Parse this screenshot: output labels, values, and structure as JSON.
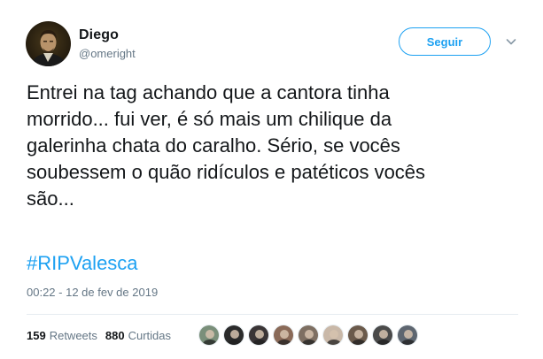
{
  "author": {
    "display_name": "Diego",
    "username": "@omeright",
    "avatar_icon": "profile-photo-icon"
  },
  "follow_label": "Seguir",
  "tweet_text": {
    "lines": [
      "Entrei na tag achando que a cantora tinha",
      "morrido... fui ver, é só mais um chilique da",
      "galerinha chata do caralho. Sério, se vocês",
      "soubessem o quão ridículos e patéticos vocês",
      "são..."
    ]
  },
  "hashtag": "#RIPValesca",
  "timestamp": "00:22 - 12 de fev de 2019",
  "stats": {
    "retweets_count": "159",
    "retweets_label": "Retweets",
    "likes_count": "880",
    "likes_label": "Curtidas"
  },
  "likers": [
    {
      "name": "liker-avatar-1",
      "color": "#7a8f7a"
    },
    {
      "name": "liker-avatar-2",
      "color": "#2b2b2b"
    },
    {
      "name": "liker-avatar-3",
      "color": "#3a3536"
    },
    {
      "name": "liker-avatar-4",
      "color": "#8a6a58"
    },
    {
      "name": "liker-avatar-5",
      "color": "#7e6f62"
    },
    {
      "name": "liker-avatar-6",
      "color": "#c9b8a8"
    },
    {
      "name": "liker-avatar-7",
      "color": "#6b5a4b"
    },
    {
      "name": "liker-avatar-8",
      "color": "#4a4a4a"
    },
    {
      "name": "liker-avatar-9",
      "color": "#5e6670"
    }
  ],
  "colors": {
    "accent": "#1da1f2",
    "text": "#14171a",
    "muted": "#657786",
    "divider": "#e6ecf0"
  }
}
